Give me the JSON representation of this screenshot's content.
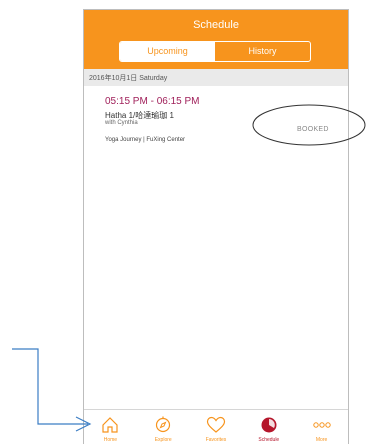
{
  "header": {
    "title": "Schedule"
  },
  "segments": {
    "upcoming": "Upcoming",
    "history": "History"
  },
  "date_header": "2016年10月1日 Saturday",
  "class": {
    "time": "05:15 PM - 06:15 PM",
    "name": "Hatha 1/哈達瑜珈 1",
    "instructor": "with Cynthia",
    "location": "Yoga Journey | FuXing Center",
    "status": "BOOKED"
  },
  "tabbar": {
    "items": [
      {
        "label": "Home",
        "icon": "home-icon"
      },
      {
        "label": "Explore",
        "icon": "compass-icon"
      },
      {
        "label": "Favorites",
        "icon": "heart-icon"
      },
      {
        "label": "Schedule",
        "icon": "schedule-icon",
        "active": true
      },
      {
        "label": "More",
        "icon": "more-icon"
      }
    ]
  },
  "colors": {
    "brand_orange": "#f7941d",
    "class_time": "#a0205a",
    "active_tab": "#b5162b",
    "annotation_blue": "#3b7dc4"
  }
}
